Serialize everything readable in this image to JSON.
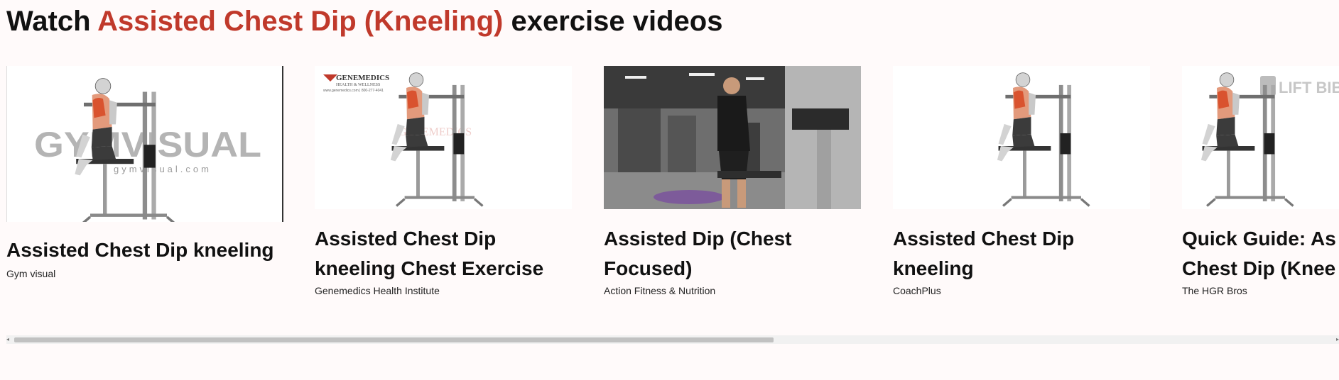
{
  "heading": {
    "prefix": "Watch",
    "exercise": "Assisted Chest Dip (Kneeling)",
    "suffix": "exercise videos",
    "accent_color": "#c0392b"
  },
  "videos": [
    {
      "title_line1": "Assisted Chest Dip kneeling",
      "title_line2": "",
      "source": "Gym visual",
      "watermark": "GYMVISUAL",
      "watermark_sub": "gymvisual.com",
      "thumbnail": "gym-visual-illustration"
    },
    {
      "title_line1": "Assisted Chest Dip",
      "title_line2": "kneeling Chest Exercise",
      "source": "Genemedics Health Institute",
      "logo_text": "GENEMEDICS",
      "logo_sub": "HEALTH & WELLNESS",
      "logo_url": "www.genemedics.com | 800-277-4041",
      "thumbnail": "genemedics-illustration"
    },
    {
      "title_line1": "Assisted Dip (Chest",
      "title_line2": "Focused)",
      "source": "Action Fitness & Nutrition",
      "thumbnail": "gym-photo"
    },
    {
      "title_line1": "Assisted Chest Dip",
      "title_line2": "kneeling",
      "source": "CoachPlus",
      "thumbnail": "coachplus-illustration"
    },
    {
      "title_line1": "Quick Guide: As",
      "title_line2": "Chest Dip (Knee",
      "source": "The HGR Bros",
      "logo_text": "LIFT BIB",
      "thumbnail": "hgr-illustration"
    }
  ],
  "scrollbar": {
    "left_arrow": "◂",
    "right_arrow": "▸",
    "position_fraction": 0.57
  }
}
